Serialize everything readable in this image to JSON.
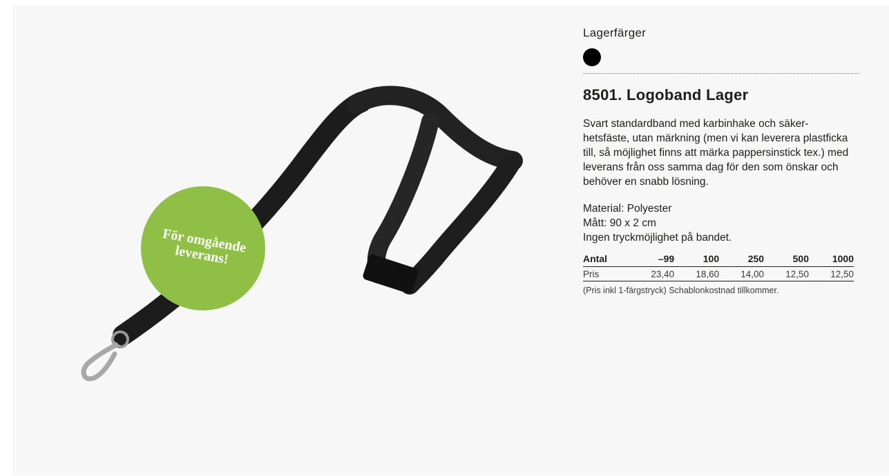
{
  "product": {
    "colors_title": "Lagerfärger",
    "swatch_color": "#000000",
    "title": "8501. Logoband Lager",
    "description": "Svart standardband med karbinhake och säker-hetsfäste, utan märkning (men vi kan leverera plastficka till, så möjlighet finns att märka pappersinstick tex.) med leverans från oss samma dag för den som önskar och behöver en snabb lösning.",
    "specs": [
      "Material: Polyester",
      "Mått: 90 x 2 cm",
      "Ingen tryckmöjlighet på bandet."
    ],
    "price_table": {
      "header": [
        "Antal",
        "–99",
        "100",
        "250",
        "500",
        "1000"
      ],
      "row": [
        "Pris",
        "23,40",
        "18,60",
        "14,00",
        "12,50",
        "12,50"
      ]
    },
    "note": "(Pris inkl 1-färgstryck) Schablonkostnad tillkommer."
  },
  "badge": {
    "line1": "För omgående",
    "line2": "leverans!",
    "color": "#8fbf45"
  }
}
